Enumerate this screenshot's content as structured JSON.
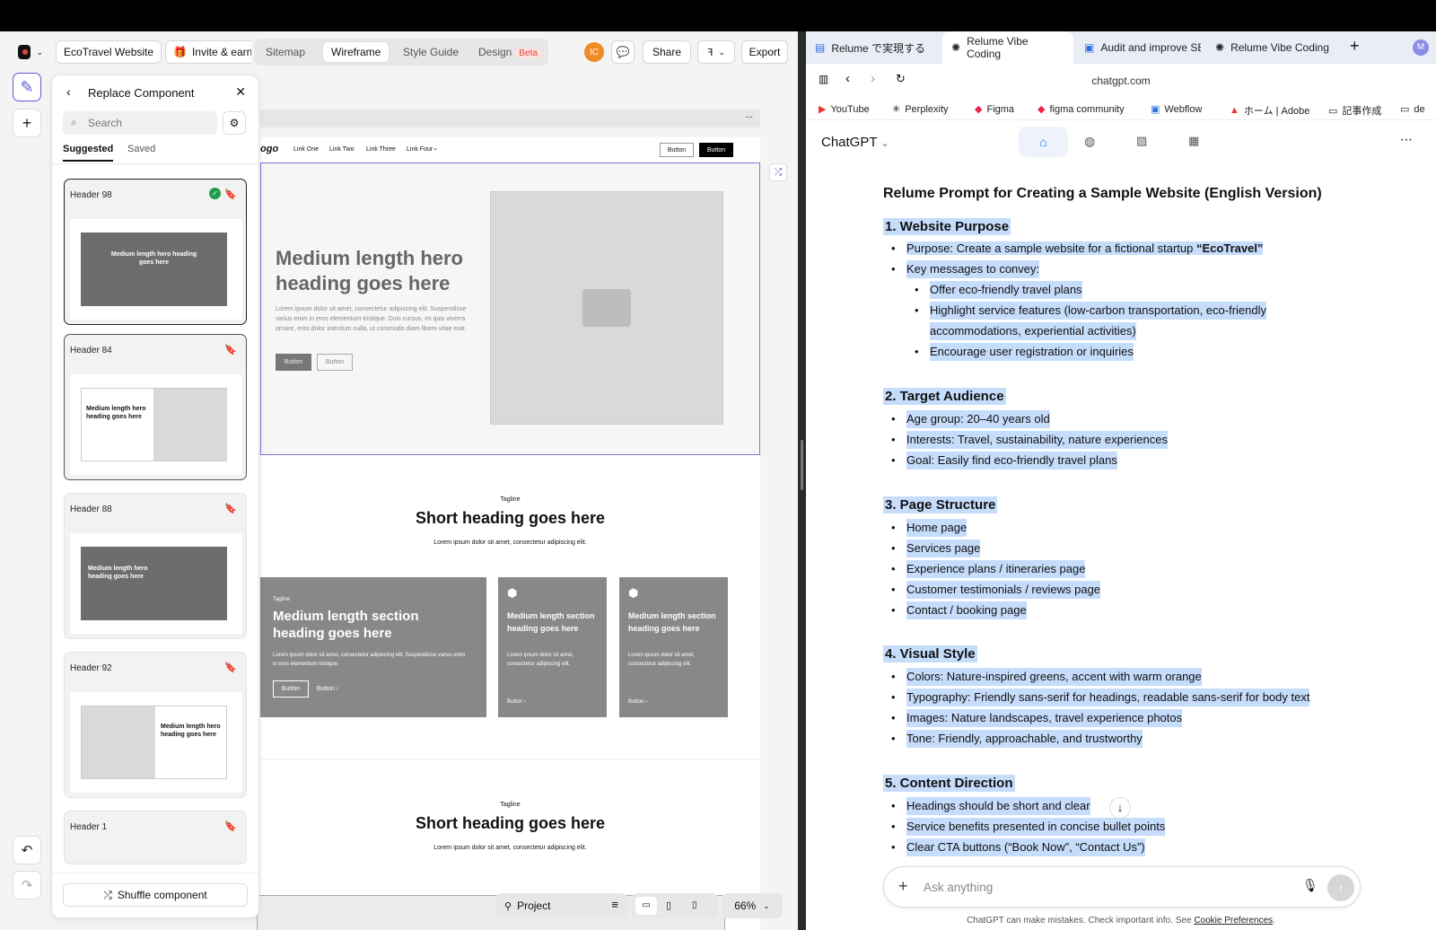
{
  "relume": {
    "project_button": "EcoTravel Website",
    "invite_label": "Invite & earn",
    "tabs": [
      "Sitemap",
      "Wireframe",
      "Style Guide",
      "Design"
    ],
    "beta_badge": "Beta",
    "avatar_initials": "IC",
    "share_label": "Share",
    "export_label": "Export",
    "panel": {
      "title": "Replace Component",
      "search_placeholder": "Search",
      "tab_suggested": "Suggested",
      "tab_saved": "Saved",
      "cards": [
        {
          "label": "Header 98",
          "heading": "Medium length hero heading goes here",
          "selected": true
        },
        {
          "label": "Header 84",
          "heading": "Medium length hero heading goes here"
        },
        {
          "label": "Header 88",
          "heading": "Medium length hero heading goes here"
        },
        {
          "label": "Header 92",
          "heading": "Medium length hero heading goes here"
        },
        {
          "label": "Header 1"
        }
      ],
      "shuffle_label": "Shuffle component"
    },
    "canvas": {
      "menu_dots": "...",
      "logo": "ogo",
      "nav_links": [
        "Link One",
        "Link Two",
        "Link Three",
        "Link Four"
      ],
      "nav_btn1": "Button",
      "nav_btn2": "Button",
      "hero_heading": "Medium length hero heading goes here",
      "hero_body": "Lorem ipsum dolor sit amet, consectetur adipiscing elit. Suspendisse varius enim in eros elementum tristique. Duis cursus, mi quis viverra ornare, eros dolor interdum nulla, ut commodo diam libero vitae erat.",
      "hero_btn1": "Button",
      "hero_btn2": "Button",
      "section1": {
        "tagline": "Tagline",
        "heading": "Short heading goes here",
        "body": "Lorem ipsum dolor sit amet, consectetur adipiscing elit.",
        "big_tagline": "Tagline",
        "big_heading": "Medium length section heading goes here",
        "big_body": "Lorem ipsum dolor sit amet, consectetur adipiscing elit. Suspendisse varius enim in eros elementum tristique.",
        "big_btn1": "Button",
        "big_btn2": "Button",
        "small_heading": "Medium length section heading goes here",
        "small_body": "Lorem ipsum dolor sit amet, consectetur adipiscing elit.",
        "small_btn": "Button"
      },
      "section2": {
        "tagline": "Tagline",
        "heading": "Short heading goes here",
        "body": "Lorem ipsum dolor sit amet, consectetur adipiscing elit."
      }
    },
    "bottom": {
      "project_label": "Project",
      "zoom": "66%"
    }
  },
  "browser": {
    "tabs": [
      {
        "label": "Relume で実現する「Vi"
      },
      {
        "label": "Relume Vibe Coding",
        "active": true
      },
      {
        "label": "Audit and improve SE"
      },
      {
        "label": "Relume Vibe Coding"
      }
    ],
    "profile": "M",
    "url": "chatgpt.com",
    "bookmarks": [
      "YouTube",
      "Perplexity",
      "Figma",
      "figma community",
      "Webflow",
      "ホーム | Adobe",
      "記事作成",
      "de"
    ]
  },
  "chatgpt": {
    "model_label": "ChatGPT",
    "title": "Relume Prompt for Creating a Sample Website (English Version)",
    "sections": [
      {
        "heading": "1. Website Purpose",
        "items": [
          "Purpose: Create a sample website for a fictional startup ",
          "Key messages to convey:"
        ],
        "purpose_brand": "“EcoTravel”",
        "subitems": [
          "Offer eco-friendly travel plans",
          "Highlight service features (low-carbon transportation, eco-friendly",
          "accommodations, experiential activities)",
          "Encourage user registration or inquiries"
        ]
      },
      {
        "heading": "2. Target Audience",
        "items": [
          "Age group: 20–40 years old",
          "Interests: Travel, sustainability, nature experiences",
          "Goal: Easily find eco-friendly travel plans"
        ]
      },
      {
        "heading": "3. Page Structure",
        "items": [
          "Home page",
          "Services page",
          "Experience plans / itineraries page",
          "Customer testimonials / reviews page",
          "Contact / booking page"
        ]
      },
      {
        "heading": "4. Visual Style",
        "items": [
          "Colors: Nature-inspired greens, accent with warm orange",
          "Typography: Friendly sans-serif for headings, readable sans-serif for body text",
          "Images: Nature landscapes, travel experience photos",
          "Tone: Friendly, approachable, and trustworthy"
        ]
      },
      {
        "heading": "5. Content Direction",
        "items": [
          "Headings should be short and clear",
          "Service benefits presented in concise bullet points",
          "Clear CTA buttons (“Book Now”, “Contact Us”)"
        ]
      }
    ],
    "input_placeholder": "Ask anything",
    "disclaimer": "ChatGPT can make mistakes. Check important info. See ",
    "disclaimer_link": "Cookie Preferences",
    "disclaimer_end": "."
  },
  "colors": {
    "accent": "#5b5bd6",
    "highlight": "#c5dcfb",
    "avatar": "#f08a24",
    "beta": "#e0463c"
  }
}
